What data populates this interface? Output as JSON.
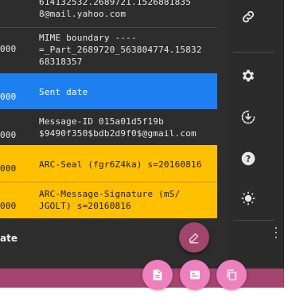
{
  "rows": [
    {
      "time": "",
      "text": "614132532.2689721.1526881835\n8@mail.yahoo.com",
      "style": "dark"
    },
    {
      "time": "000",
      "text": "MIME boundary ----\n=_Part_2689720_563804774.15832\n68318357",
      "style": "dark"
    },
    {
      "time": "000",
      "text": "Sent date",
      "style": "blue"
    },
    {
      "time": "000",
      "text": "Message-ID 015a01d5f19b\n$9490f350$bdb2d9f0$@gmail.com",
      "style": "dark"
    },
    {
      "time": "000",
      "text": "ARC-Seal (fgr6Z4ka) s=20160816",
      "style": "yellow"
    },
    {
      "time": "000",
      "text": "ARC-Message-Signature (mS/\nJGOLT) s=20160816",
      "style": "yellow"
    }
  ],
  "bottom_label": "ate",
  "sidebar_icons": [
    "link-icon",
    "gear-icon",
    "download-circle-icon",
    "help-icon",
    "brightness-icon"
  ],
  "colors": {
    "panel": "#2d2d2d",
    "highlight_blue": "#1e7ff0",
    "highlight_yellow": "#ffc000",
    "accent_pink": "#a0466d",
    "fab_pink": "#ee80be"
  },
  "fab_icons": {
    "main": "draw-icon",
    "left": "file-document-icon",
    "middle": "card-icon",
    "right": "copy-icon"
  }
}
